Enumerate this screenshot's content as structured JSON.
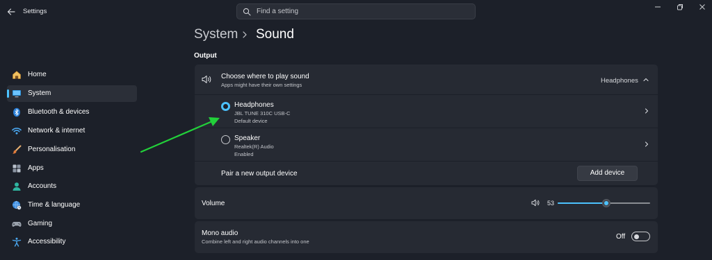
{
  "app": {
    "title": "Settings"
  },
  "search": {
    "placeholder": "Find a setting"
  },
  "sidebar": {
    "items": [
      {
        "label": "Home",
        "icon": "home-icon"
      },
      {
        "label": "System",
        "icon": "monitor-icon",
        "active": true
      },
      {
        "label": "Bluetooth & devices",
        "icon": "bluetooth-icon"
      },
      {
        "label": "Network & internet",
        "icon": "wifi-icon"
      },
      {
        "label": "Personalisation",
        "icon": "brush-icon"
      },
      {
        "label": "Apps",
        "icon": "apps-icon"
      },
      {
        "label": "Accounts",
        "icon": "person-icon"
      },
      {
        "label": "Time & language",
        "icon": "globe-clock-icon"
      },
      {
        "label": "Gaming",
        "icon": "gamepad-icon"
      },
      {
        "label": "Accessibility",
        "icon": "accessibility-icon"
      }
    ]
  },
  "page": {
    "breadcrumb_parent": "System",
    "breadcrumb_current": "Sound",
    "output_section": "Output"
  },
  "output": {
    "title": "Choose where to play sound",
    "subtitle": "Apps might have their own settings",
    "current_device": "Headphones",
    "devices": [
      {
        "name": "Headphones",
        "detail": "JBL TUNE 310C USB-C",
        "status": "Default device",
        "selected": true
      },
      {
        "name": "Speaker",
        "detail": "Realtek(R) Audio",
        "status": "Enabled",
        "selected": false
      }
    ],
    "pair_label": "Pair a new output device",
    "add_button": "Add device"
  },
  "volume": {
    "label": "Volume",
    "value": "53",
    "level": 0.53
  },
  "mono": {
    "title": "Mono audio",
    "subtitle": "Combine left and right audio channels into one",
    "state_label": "Off",
    "enabled": false
  },
  "colors": {
    "accent": "#4cc2ff",
    "background": "#1c2029",
    "card": "#262a33",
    "annotation_arrow": "#22d03a"
  }
}
